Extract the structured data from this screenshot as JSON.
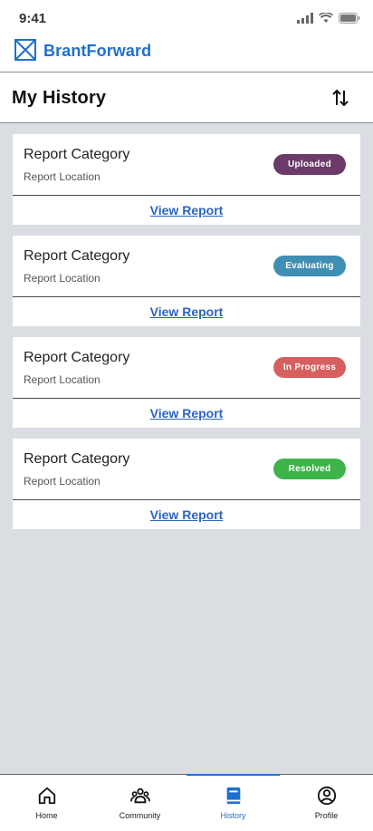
{
  "status_bar": {
    "time": "9:41"
  },
  "brand": {
    "name": "BrantForward",
    "color": "#1f6fd1"
  },
  "header": {
    "title": "My History",
    "sort_icon": "sort-arrows-icon"
  },
  "reports": [
    {
      "category": "Report Category",
      "location": "Report Location",
      "status": "Uploaded",
      "status_color": "#6a3b6b",
      "link": "View Report"
    },
    {
      "category": "Report Category",
      "location": "Report Location",
      "status": "Evaluating",
      "status_color": "#3f8fb5",
      "link": "View Report"
    },
    {
      "category": "Report Category",
      "location": "Report Location",
      "status": "In Progress",
      "status_color": "#d6605f",
      "link": "View Report"
    },
    {
      "category": "Report Category",
      "location": "Report Location",
      "status": "Resolved",
      "status_color": "#3db34a",
      "link": "View Report"
    }
  ],
  "tabs": [
    {
      "label": "Home",
      "icon": "home-icon"
    },
    {
      "label": "Community",
      "icon": "community-icon"
    },
    {
      "label": "History",
      "icon": "book-icon",
      "active": true
    },
    {
      "label": "Profile",
      "icon": "user-icon"
    }
  ]
}
